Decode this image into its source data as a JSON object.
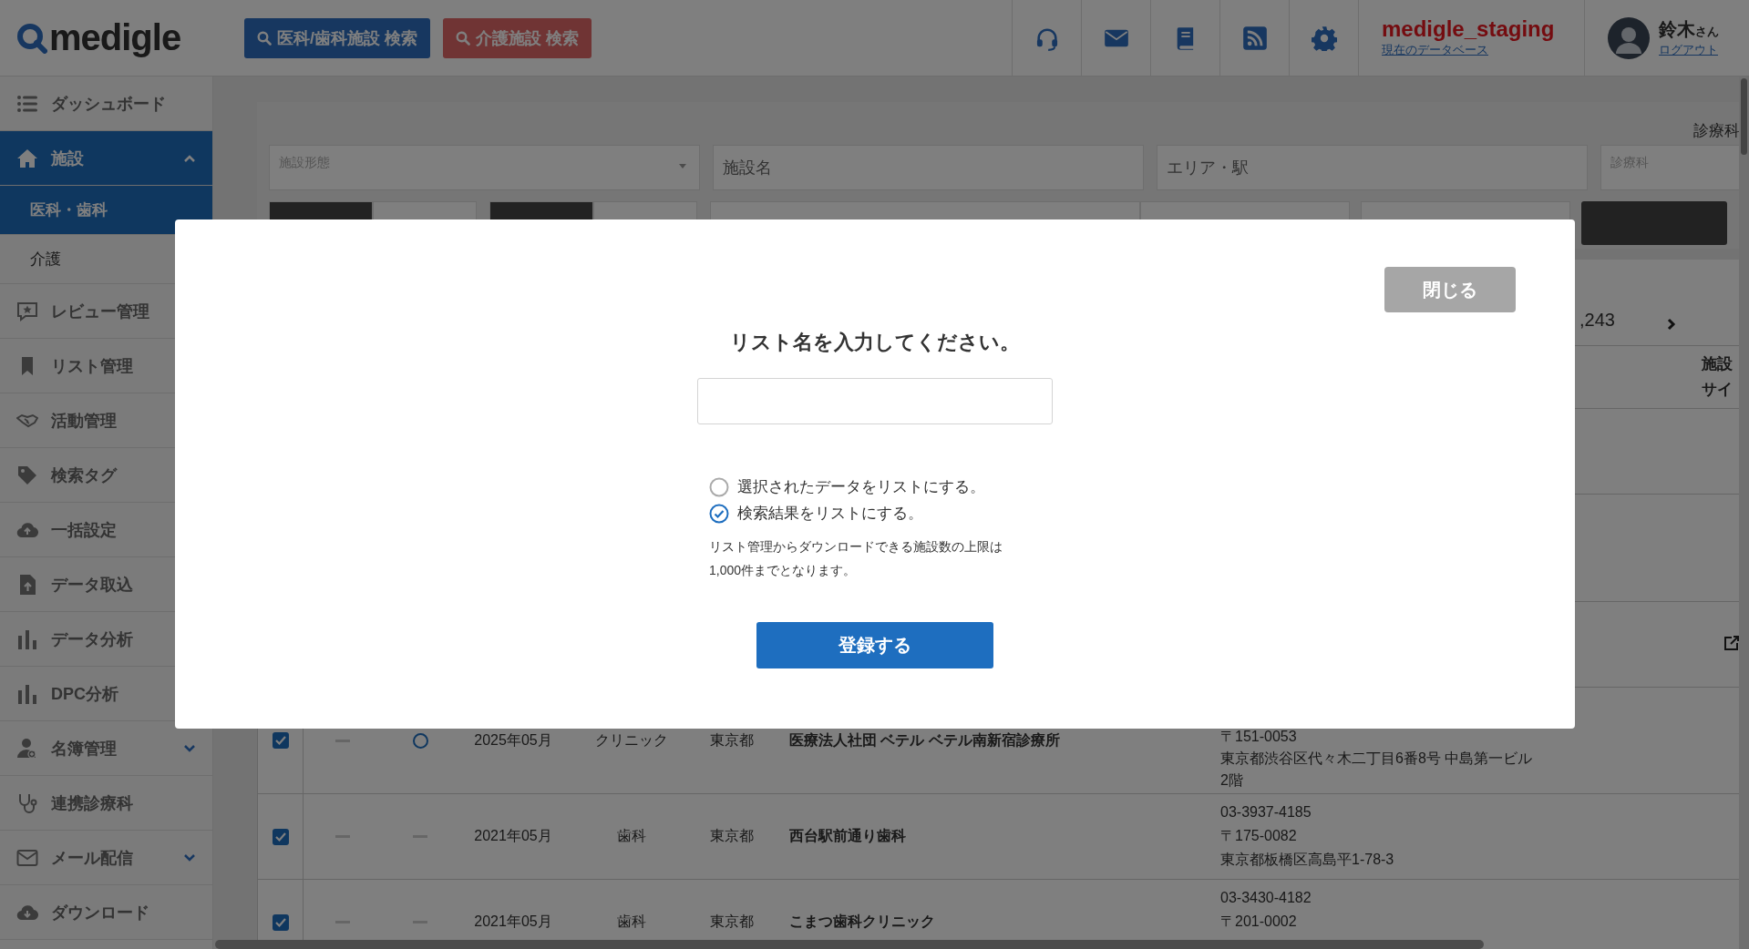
{
  "header": {
    "logo": "medigle",
    "search_buttons": [
      {
        "label": "医科/歯科施設 検索",
        "kind": "medical"
      },
      {
        "label": "介護施設 検索",
        "kind": "care"
      }
    ],
    "database": {
      "name": "medigle_staging",
      "link": "現在のデータベース"
    },
    "user": {
      "name": "鈴木",
      "suffix": "さん",
      "logout": "ログアウト"
    }
  },
  "sidebar": {
    "items": [
      {
        "label": "ダッシュボード",
        "selected": false
      },
      {
        "label": "施設",
        "selected": true,
        "expanded": true,
        "children": [
          {
            "label": "医科・歯科",
            "selected": true
          },
          {
            "label": "介護",
            "selected": false
          }
        ]
      },
      {
        "label": "レビュー管理",
        "selected": false
      },
      {
        "label": "リスト管理",
        "selected": false
      },
      {
        "label": "活動管理",
        "selected": false
      },
      {
        "label": "検索タグ",
        "selected": false
      },
      {
        "label": "一括設定",
        "selected": false
      },
      {
        "label": "データ取込",
        "selected": false
      },
      {
        "label": "データ分析",
        "selected": false
      },
      {
        "label": "DPC分析",
        "selected": false
      },
      {
        "label": "名簿管理",
        "selected": false,
        "expanded": false
      },
      {
        "label": "連携診療科",
        "selected": false
      },
      {
        "label": "メール配信",
        "selected": false,
        "expanded": false
      },
      {
        "label": "ダウンロード",
        "selected": false
      }
    ]
  },
  "filters": {
    "label": "診療科",
    "fields": [
      {
        "placeholder": "施設形態",
        "kind": "select"
      },
      {
        "placeholder": "施設名",
        "kind": "text"
      },
      {
        "placeholder": "エリア・駅",
        "kind": "text"
      },
      {
        "placeholder": "診療科",
        "kind": "select"
      }
    ],
    "controls": [
      {
        "kind": "segment",
        "selected": true
      },
      {
        "kind": "segment",
        "selected": false
      },
      {
        "kind": "segment",
        "selected": true
      },
      {
        "kind": "segment",
        "selected": false
      },
      {
        "kind": "field"
      },
      {
        "kind": "check"
      },
      {
        "kind": "check"
      },
      {
        "kind": "button"
      }
    ]
  },
  "results": {
    "count": ",243"
  },
  "table": {
    "header_lines": [
      "施設",
      "サイ"
    ],
    "rows": [
      {
        "link_icon": false
      },
      {
        "link_icon": false
      },
      {
        "link_icon": true
      },
      {
        "checked": true,
        "marks": [
          {
            "kind": "dash"
          },
          {
            "kind": "circle"
          }
        ],
        "date": "2025年05月",
        "type": "クリニック",
        "prefecture": "東京都",
        "name": "医療法人社団 ベテル ベテル南新宿診療所",
        "contact": [
          "〒151-0053",
          "東京都渋谷区代々木二丁目6番8号 中島第一ビル2階"
        ]
      },
      {
        "checked": true,
        "marks": [
          {
            "kind": "dash"
          },
          {
            "kind": "dash"
          }
        ],
        "date": "2021年05月",
        "type": "歯科",
        "prefecture": "東京都",
        "name": "西台駅前通り歯科",
        "contact": [
          "03-3937-4185",
          "〒175-0082",
          "東京都板橋区高島平1-78-3"
        ]
      },
      {
        "checked": true,
        "marks": [
          {
            "kind": "dash"
          },
          {
            "kind": "dash"
          }
        ],
        "date": "2021年05月",
        "type": "歯科",
        "prefecture": "東京都",
        "name": "こまつ歯科クリニック",
        "contact": [
          "03-3430-4182",
          "〒201-0002"
        ]
      }
    ]
  },
  "dialog": {
    "close": "閉じる",
    "title": "リスト名を入力してください。",
    "input": {
      "kind": "text"
    },
    "options": [
      {
        "label": "選択されたデータをリストにする。",
        "selected": false
      },
      {
        "label": "検索結果をリストにする。",
        "selected": true
      }
    ],
    "note": "リスト管理からダウンロードできる施設数の上限は\n1,000件までとなります。",
    "submit": "登録する"
  }
}
